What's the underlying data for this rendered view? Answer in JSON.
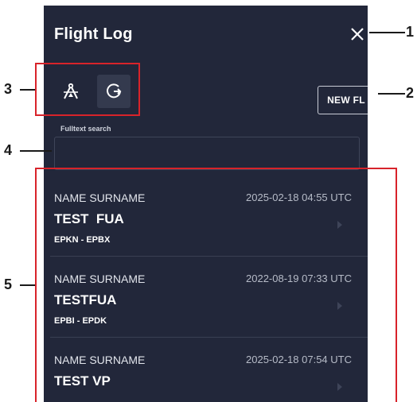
{
  "header": {
    "title": "Flight Log"
  },
  "toolbar": {
    "new_label": "NEW FL"
  },
  "search": {
    "label": "Fulltext search",
    "value": "",
    "placeholder": ""
  },
  "entries": [
    {
      "name": "NAME SURNAME",
      "time": "2025-02-18 04:55 UTC",
      "flight": "TEST  FUA",
      "route": "EPKN - EPBX"
    },
    {
      "name": "NAME SURNAME",
      "time": "2022-08-19 07:33 UTC",
      "flight": "TESTFUA",
      "route": "EPBI - EPDK"
    },
    {
      "name": "NAME SURNAME",
      "time": "2025-02-18 07:54 UTC",
      "flight": "TEST VP",
      "route": ""
    }
  ],
  "callouts": [
    "1",
    "2",
    "3",
    "4",
    "5"
  ],
  "colors": {
    "panel": "#22273a",
    "callout_red": "#d8232a"
  },
  "icons": {
    "mode_a": "compass-icon",
    "mode_b": "circle-arrow-icon",
    "close": "close-icon",
    "chevron": "chevron-right-icon"
  }
}
